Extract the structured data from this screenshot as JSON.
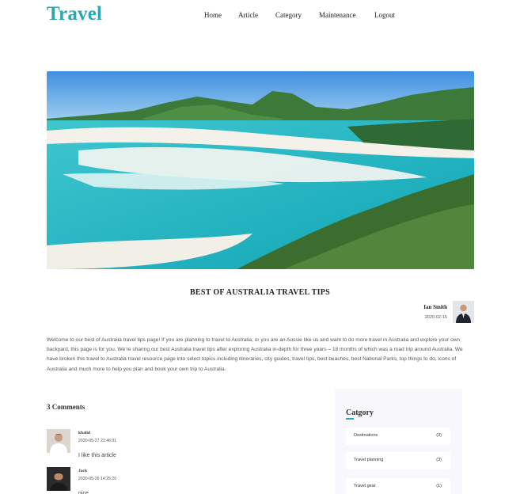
{
  "header": {
    "brand": "Travel",
    "nav": [
      "Home",
      "Article",
      "Category",
      "Maintenance",
      "Logout"
    ]
  },
  "post": {
    "title": "BEST OF AUSTRALIA TRAVEL TIPS",
    "author": "Ian Smith",
    "date": "2020-02-15",
    "body": "Welcome to our best of Australia travel tips page! If you are planning to travel to Australia, or you are an Aussie like us and want to do more travel in Australia and explore your own backyard, this page is for you. We’re sharing our best Australia travel tips after exploring Australia in-depth for three years – 18 months of which was a road trip around Australia. We have broken this travel to Australia travel resource page into select topics including itineraries, city guides, travel tips, best beaches, best National Parks, top things to do, icons of Australia and much more to help you plan and book your own trip to Australia."
  },
  "comments": {
    "heading": "3 Comments",
    "items": [
      {
        "name": "khalid",
        "date": "2020-05-27 22:46:31",
        "text": "I like this article"
      },
      {
        "name": "Jack",
        "date": "2020-05-26 14:25:20",
        "text": "nice"
      }
    ]
  },
  "sidebar": {
    "title": "Catgory",
    "categories": [
      {
        "label": "Destinations",
        "count": "(3)"
      },
      {
        "label": "Travel planning",
        "count": "(3)"
      },
      {
        "label": "Travel gear",
        "count": "(1)"
      }
    ]
  },
  "colors": {
    "brand": "#2aa6b5",
    "sidebar_bg": "#f7f7fc"
  }
}
